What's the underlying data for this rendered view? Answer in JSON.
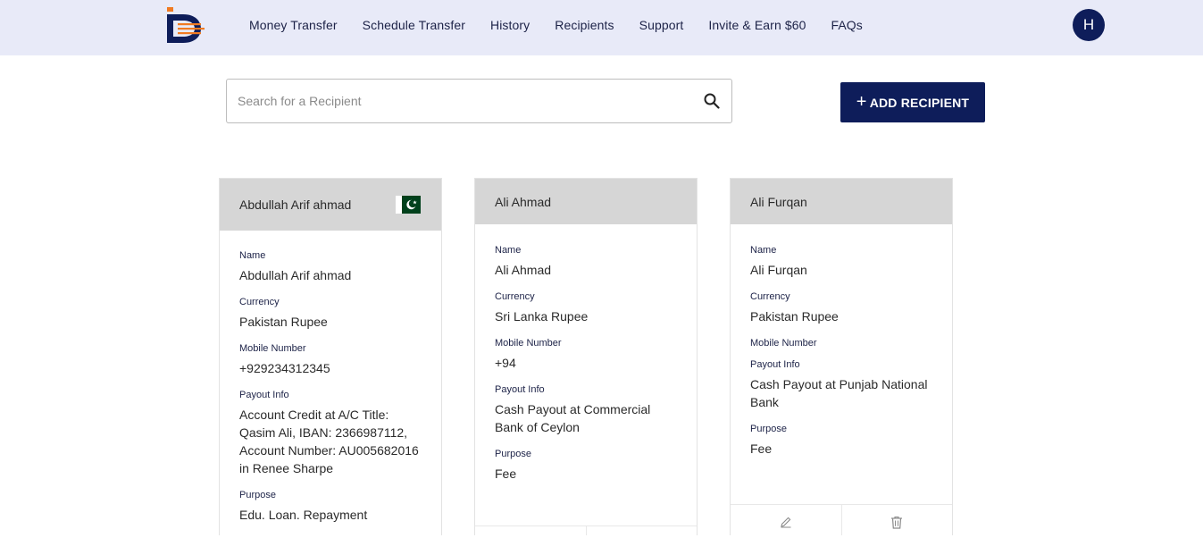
{
  "header": {
    "nav": [
      "Money Transfer",
      "Schedule Transfer",
      "History",
      "Recipients",
      "Support",
      "Invite & Earn $60",
      "FAQs"
    ],
    "avatar_initial": "H"
  },
  "search": {
    "placeholder": "Search for a Recipient",
    "value": ""
  },
  "add_button": {
    "label": "ADD RECIPIENT"
  },
  "labels": {
    "name": "Name",
    "currency": "Currency",
    "mobile": "Mobile Number",
    "payout": "Payout Info",
    "purpose": "Purpose"
  },
  "recipients": [
    {
      "title": "Abdullah Arif ahmad",
      "flag": "pakistan-flag",
      "name": "Abdullah Arif ahmad",
      "currency": "Pakistan Rupee",
      "mobile": "+929234312345",
      "payout": "Account Credit at A/C Title: Qasim Ali, IBAN: 2366987112, Account Number: AU005682016 in Renee Sharpe",
      "purpose": "Edu. Loan. Repayment"
    },
    {
      "title": "Ali Ahmad",
      "name": "Ali Ahmad",
      "currency": "Sri Lanka Rupee",
      "mobile": "+94",
      "payout": "Cash Payout at Commercial Bank of Ceylon",
      "purpose": "Fee"
    },
    {
      "title": "Ali Furqan",
      "name": "Ali Furqan",
      "currency": "Pakistan Rupee",
      "mobile": "",
      "payout": "Cash Payout at Punjab National Bank",
      "purpose": "Fee"
    }
  ],
  "colors": {
    "header_bg": "#e8eaf8",
    "brand_navy": "#0e1d5a",
    "logo_orange": "#f07a22",
    "card_head_bg": "#d6d6d6"
  }
}
